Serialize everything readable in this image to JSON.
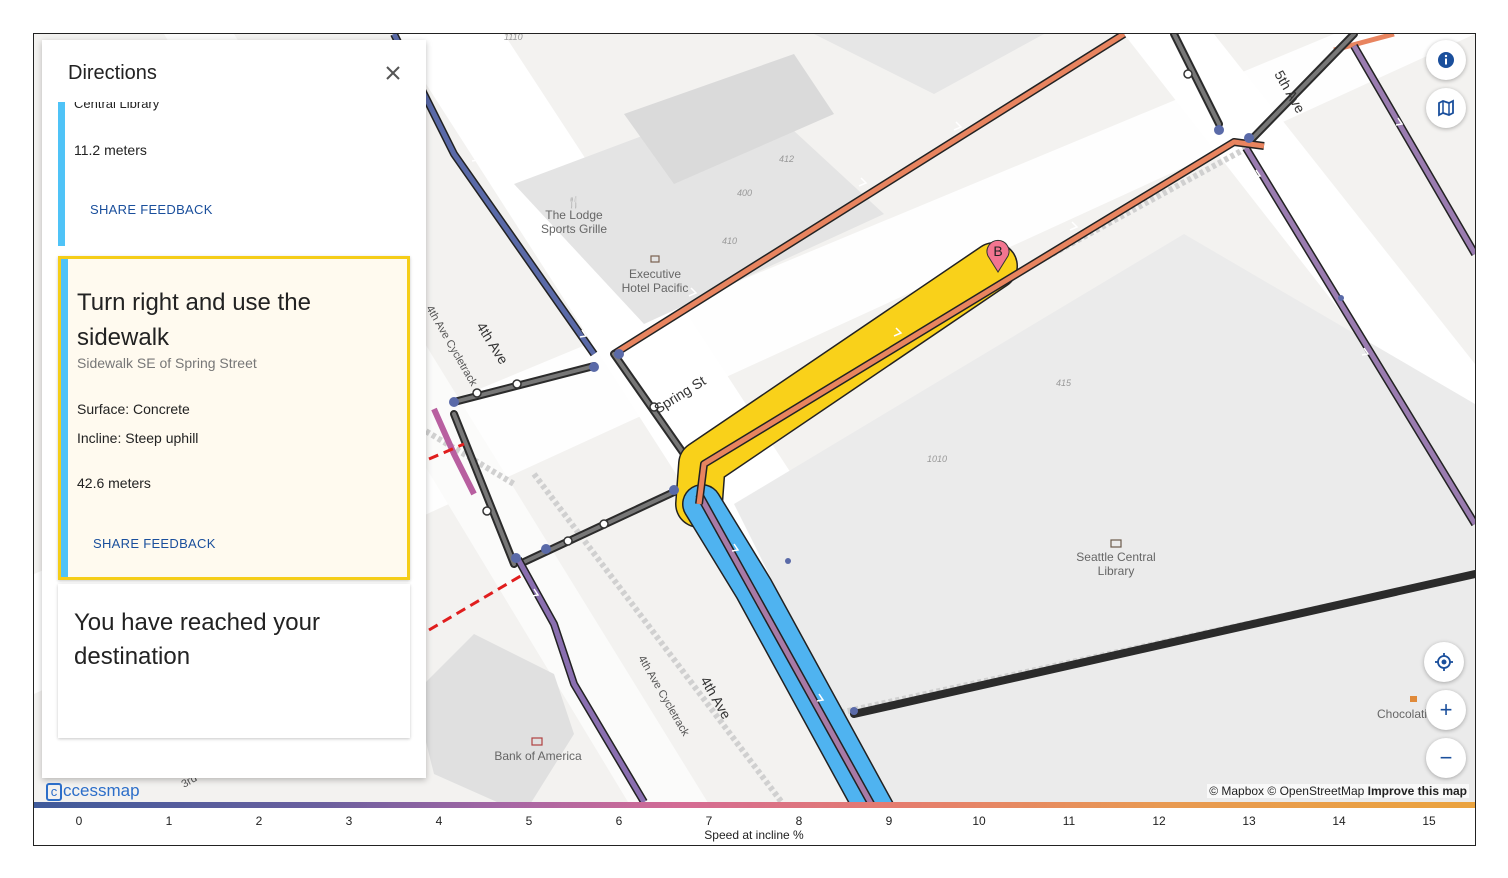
{
  "panel": {
    "title": "Directions",
    "steps": [
      {
        "name": "Central Library",
        "distance": "11.2 meters",
        "feedback": "SHARE FEEDBACK"
      },
      {
        "instruction": "Turn right and use the sidewalk",
        "street": "Sidewalk SE of Spring Street",
        "surface": "Surface: Concrete",
        "incline": "Incline: Steep uphill",
        "distance": "42.6 meters",
        "feedback": "SHARE FEEDBACK"
      },
      {
        "instruction": "You have reached your destination"
      }
    ]
  },
  "map": {
    "marker": "B",
    "streets": {
      "spring_st": "Spring St",
      "fourth_ave_top": "4th Ave",
      "fourth_ave_bottom": "4th Ave",
      "fifth_ave": "5th Ave",
      "cycletrack_top": "4th Ave Cycletrack",
      "cycletrack_bottom": "4th Ave Cycletrack",
      "third_ave": "3rd"
    },
    "pois": {
      "lodge_line1": "The Lodge",
      "lodge_line2": "Sports Grille",
      "hotel_line1": "Executive",
      "hotel_line2": "Hotel Pacific",
      "library_line1": "Seattle Central",
      "library_line2": "Library",
      "bank": "Bank of America",
      "choco": "Chocolati"
    },
    "numbers": [
      "1110",
      "412",
      "400",
      "410",
      "415",
      "1010"
    ]
  },
  "controls": {
    "info_icon": "info-icon",
    "layers_icon": "map-icon",
    "locate_icon": "locate-icon",
    "zoom_in": "+",
    "zoom_out": "−"
  },
  "legend": {
    "ticks": [
      "0",
      "1",
      "2",
      "3",
      "4",
      "5",
      "6",
      "7",
      "8",
      "9",
      "10",
      "11",
      "12",
      "13",
      "14",
      "15"
    ],
    "title": "Speed at incline %"
  },
  "attribution": {
    "mapbox": "© Mapbox",
    "osm": "© OpenStreetMap",
    "improve": "Improve this map"
  },
  "logo": {
    "text": "ccessmap"
  },
  "colors": {
    "route_highlight": "#f9d11a",
    "route_blue": "#4fb3f0",
    "selected_border": "#f5cd18",
    "link_blue": "#1a4f9c"
  }
}
